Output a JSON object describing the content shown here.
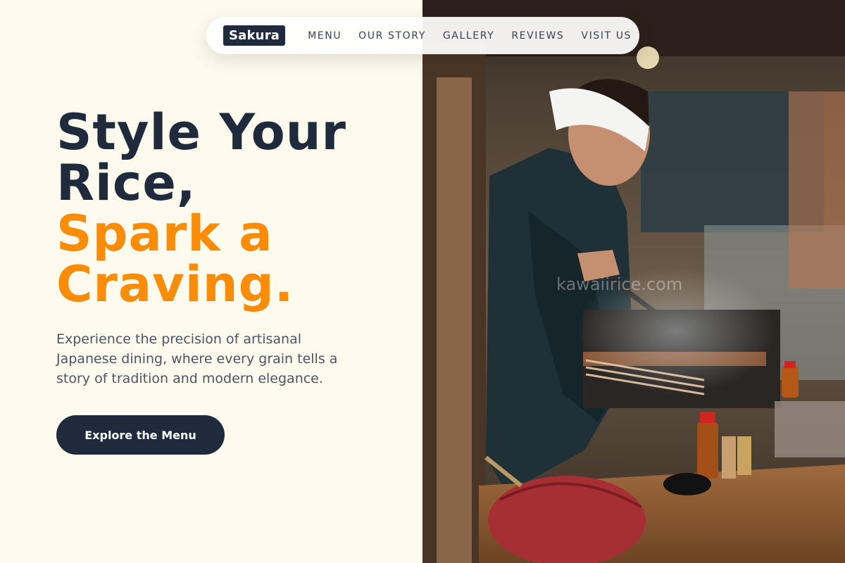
{
  "brand": {
    "logo": "Sakura"
  },
  "nav": {
    "items": [
      "MENU",
      "OUR STORY",
      "GALLERY",
      "REVIEWS",
      "VISIT US"
    ]
  },
  "hero": {
    "headline_dark_1": "Style Your",
    "headline_dark_2": "Rice,",
    "headline_accent_1": "Spark a",
    "headline_accent_2": "Craving.",
    "subtitle": "Experience the precision of artisanal Japanese dining, where every grain tells a story of tradition and modern elegance.",
    "cta": "Explore the Menu"
  },
  "photo": {
    "watermark": "kawaiirice.com"
  },
  "colors": {
    "navy": "#1f2a3d",
    "accent": "#fb8c07",
    "cream": "#fefaee"
  }
}
